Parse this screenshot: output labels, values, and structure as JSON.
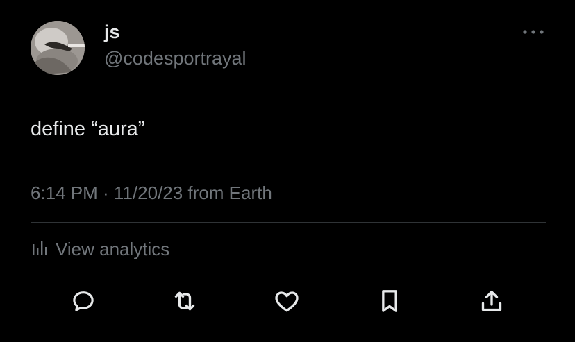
{
  "author": {
    "display_name": "js",
    "handle": "@codesportrayal"
  },
  "tweet": {
    "text": "define “aura”",
    "timestamp": "6:14 PM · 11/20/23 from Earth"
  },
  "analytics": {
    "label": "View analytics"
  },
  "icons": {
    "more": "more-horizontal-icon",
    "analytics": "bar-chart-icon",
    "reply": "reply-icon",
    "retweet": "retweet-icon",
    "like": "heart-icon",
    "bookmark": "bookmark-icon",
    "share": "share-icon"
  },
  "colors": {
    "background": "#000000",
    "primary_text": "#e7e9ea",
    "secondary_text": "#71767b",
    "divider": "#2f3336"
  }
}
